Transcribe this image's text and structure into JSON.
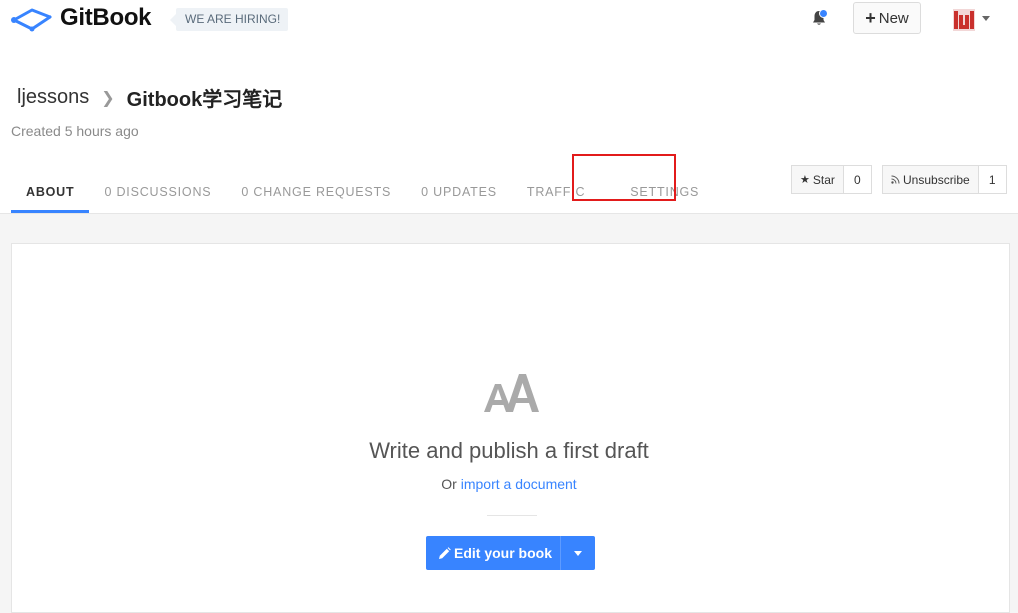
{
  "app": {
    "brand": "GitBook",
    "hiring_badge": "WE ARE HIRING!",
    "new_button_label": "New",
    "icons": {
      "logo": "gitbook-logo-icon",
      "notifications": "bell-icon",
      "new": "plus-icon",
      "avatar": "user-avatar",
      "menu": "caret-down-icon"
    },
    "colors": {
      "accent": "#3884ff",
      "highlight": "#e21b1b"
    }
  },
  "book": {
    "owner": "ljessons",
    "title": "Gitbook学习笔记",
    "created": "Created 5 hours ago"
  },
  "tabs": [
    {
      "label": "ABOUT",
      "active": true
    },
    {
      "label": "0 DISCUSSIONS",
      "active": false
    },
    {
      "label": "0 CHANGE REQUESTS",
      "active": false
    },
    {
      "label": "0 UPDATES",
      "active": false
    },
    {
      "label": "TRAFFIC",
      "active": false
    },
    {
      "label": "SETTINGS",
      "active": false
    }
  ],
  "actions": {
    "star_label": "Star",
    "star_count": "0",
    "unsubscribe_label": "Unsubscribe",
    "unsubscribe_count": "1"
  },
  "empty_state": {
    "title": "Write and publish a first draft",
    "import_prefix": "Or",
    "import_link": "import a document",
    "edit_button": "Edit your book"
  }
}
